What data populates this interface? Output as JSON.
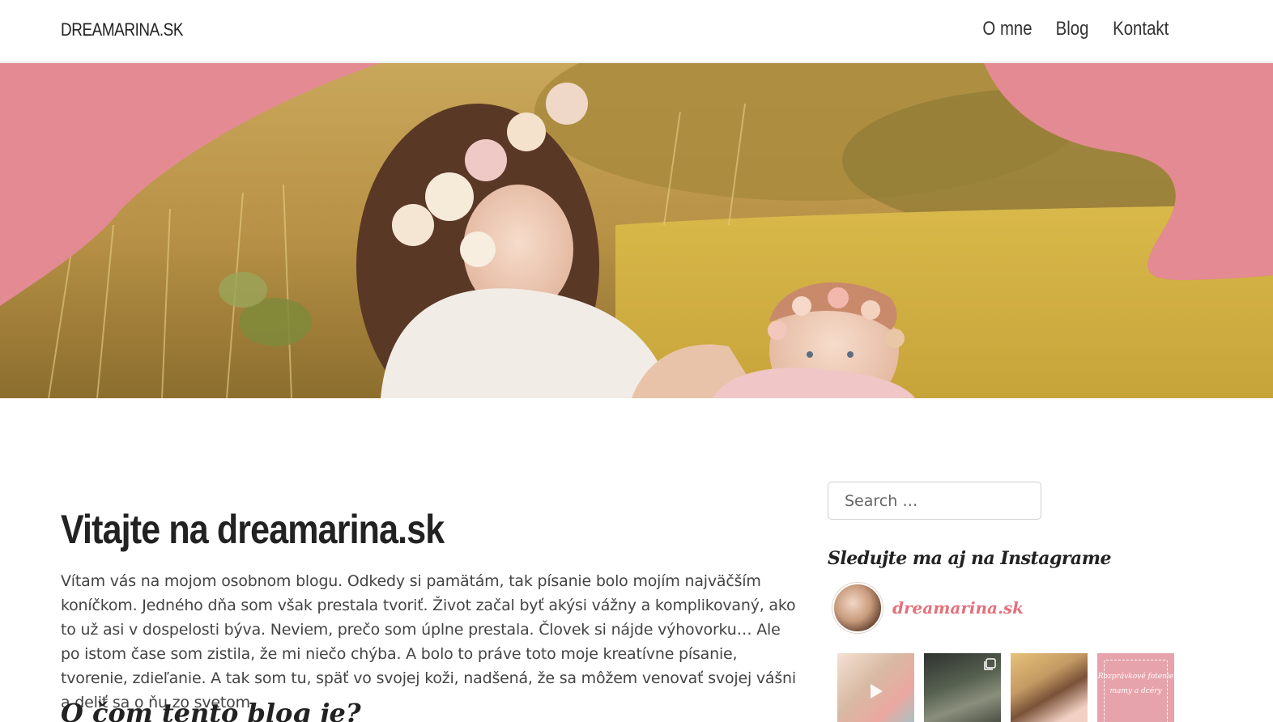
{
  "header": {
    "brand": "DREAMARINA.SK",
    "nav": [
      "O mne",
      "Blog",
      "Kontakt"
    ]
  },
  "hero": {
    "accent_color": "#e48a92",
    "image_description_icon": "hero-photo"
  },
  "main": {
    "title": "Vitajte na dreamarina.sk",
    "intro": "Vítam vás na mojom osobnom blogu. Odkedy si pamätám, tak písanie bolo mojím najväčším koníčkom. Jedného dňa som však prestala tvoriť. Život začal byť akýsi vážny a komplikovaný, ako to už asi v dospelosti býva. Neviem, prečo som úplne prestala. Človek si nájde výhovorku… Ale po istom čase som zistila, že mi niečo chýba. A bolo to práve toto moje kreatívne písanie, tvorenie, zdieľanie. A tak som tu, späť vo svojej koži, nadšená, že sa môžem venovať svojej vášni a deliť sa o ňu zo svetom.",
    "subtitle": "O čom tento blog je?"
  },
  "sidebar": {
    "search_placeholder": "Search …",
    "instagram_heading": "Sledujte ma aj na Instagrame",
    "instagram_user": "dreamarina.sk",
    "instagram_user_color": "#e4707b",
    "tiles": [
      {
        "type": "video",
        "icon": "play-icon"
      },
      {
        "type": "carousel",
        "icon": "multiple-images-icon"
      },
      {
        "type": "image",
        "icon": ""
      },
      {
        "type": "text-card",
        "text": "Rozprávkové fotenie mamy a dcéry"
      }
    ]
  }
}
